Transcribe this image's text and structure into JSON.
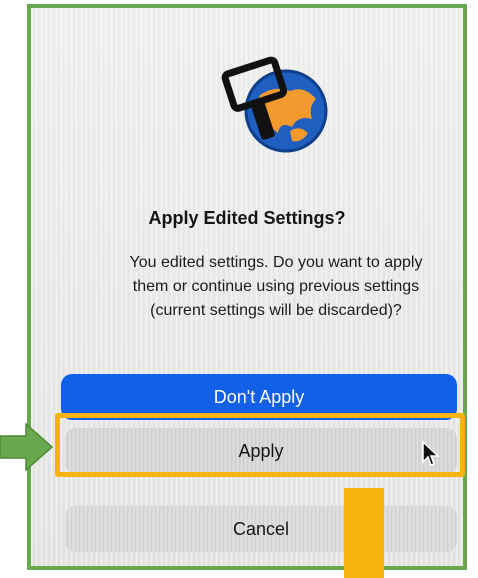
{
  "dialog": {
    "title": "Apply Edited Settings?",
    "message": "You edited settings. Do you want to apply them or continue using previous settings (current settings will be discarded)?",
    "icon": "keyboard-maestro-app-icon"
  },
  "buttons": {
    "dont_apply": "Don't Apply",
    "apply": "Apply",
    "cancel": "Cancel"
  },
  "annotations": {
    "frame_color": "#6aa84f",
    "highlight_color": "#f7b30d",
    "arrow_left_color": "#6aa84f",
    "arrow_down_color": "#f7b30d"
  },
  "colors": {
    "primary_button": "#1260e8",
    "secondary_button": "#d6d6d4"
  }
}
